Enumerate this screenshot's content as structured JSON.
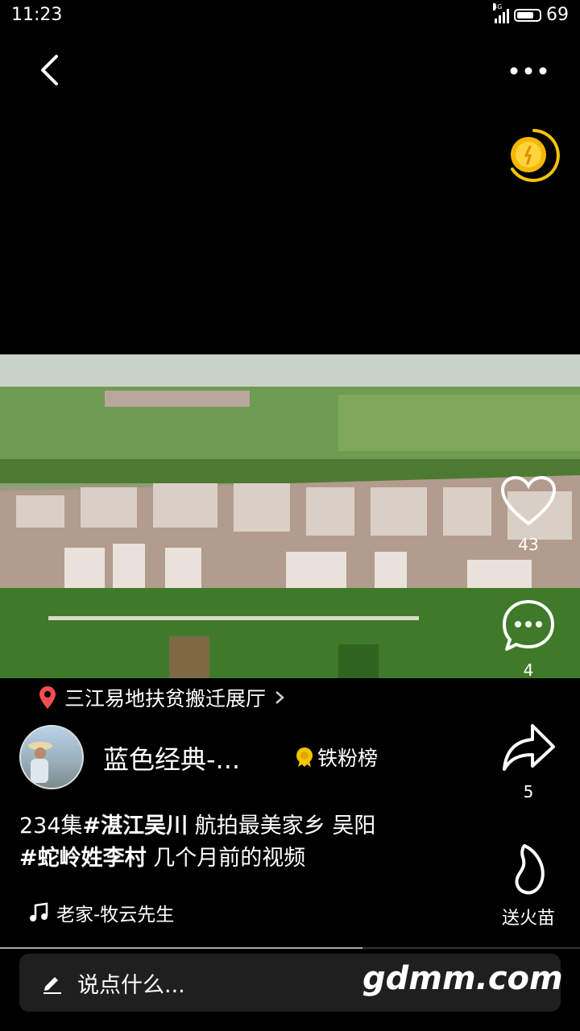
{
  "status": {
    "time": "11:23",
    "network": "4G",
    "battery": "69"
  },
  "rail": {
    "likes": "43",
    "comments": "4",
    "shares": "5",
    "gift_label": "送火苗"
  },
  "location": {
    "name": "三江易地扶贫搬迁展厅"
  },
  "author": {
    "name": "蓝色经典-...",
    "fans_label": "铁粉榜"
  },
  "caption": {
    "part1": "234集",
    "tag1": "#湛江吴川",
    "part2": " 航拍最美家乡  吴阳",
    "tag2": "#蛇岭姓李村",
    "part3": " 几个月前的视频"
  },
  "music": {
    "title": "老家-牧云先生"
  },
  "comment": {
    "placeholder": "说点什么..."
  },
  "watermark": "gdmm.com",
  "playback": {
    "progress": 0.625
  },
  "colors": {
    "accent_gold": "#f5c400",
    "location_pin": "#f04f4f"
  }
}
